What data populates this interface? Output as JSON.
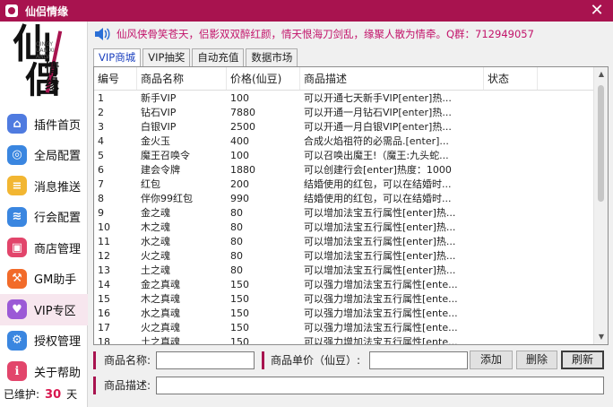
{
  "window": {
    "title": "仙侣情缘",
    "close_glyph": "✕"
  },
  "logo": {
    "main_top": "仙",
    "main_bottom": "侣",
    "small": "情缘",
    "pinyin": "QINGYUAN XIANLV"
  },
  "sidebar": {
    "items": [
      {
        "label": "插件首页",
        "icon": "home-icon",
        "color": "#4f7be0",
        "glyph": "⌂"
      },
      {
        "label": "全局配置",
        "icon": "settings-icon",
        "color": "#3a86e0",
        "glyph": "◎"
      },
      {
        "label": "消息推送",
        "icon": "message-icon",
        "color": "#f2b632",
        "glyph": "≡"
      },
      {
        "label": "行会配置",
        "icon": "layers-icon",
        "color": "#3a86e0",
        "glyph": "≋"
      },
      {
        "label": "商店管理",
        "icon": "shop-icon",
        "color": "#e2456b",
        "glyph": "▣"
      },
      {
        "label": "GM助手",
        "icon": "gm-icon",
        "color": "#f26b2a",
        "glyph": "⚒"
      },
      {
        "label": "VIP专区",
        "icon": "vip-icon",
        "color": "#9b59d6",
        "glyph": "♥"
      },
      {
        "label": "授权管理",
        "icon": "auth-icon",
        "color": "#3a86e0",
        "glyph": "⚙"
      },
      {
        "label": "关于帮助",
        "icon": "info-icon",
        "color": "#e2456b",
        "glyph": "ℹ"
      }
    ],
    "active_index": 6,
    "maintained_label": "已维护:",
    "maintained_days": "30",
    "maintained_unit": "天"
  },
  "notice": {
    "text": "仙风侠骨笑苍天，侣影双双醉红颜，情天恨海刀剑乱，缘聚人散为情牵。Q群：712949057"
  },
  "tabs": [
    {
      "label": "VIP商城",
      "active": true
    },
    {
      "label": "VIP抽奖",
      "active": false
    },
    {
      "label": "自动充值",
      "active": false
    },
    {
      "label": "数据市场",
      "active": false
    }
  ],
  "table": {
    "headers": [
      "编号",
      "商品名称",
      "价格(仙豆)",
      "商品描述",
      "状态"
    ],
    "rows": [
      [
        "1",
        "新手VIP",
        "100",
        "可以开通七天新手VIP[enter]热...",
        ""
      ],
      [
        "2",
        "钻石VIP",
        "7880",
        "可以开通一月钻石VIP[enter]热...",
        ""
      ],
      [
        "3",
        "白银VIP",
        "2500",
        "可以开通一月白银VIP[enter]热...",
        ""
      ],
      [
        "4",
        "金火玉",
        "400",
        "合成火焰祖符的必需品.[enter]...",
        ""
      ],
      [
        "5",
        "魔王召唤令",
        "100",
        "可以召唤出魔王!（魔王:九头蛇...",
        ""
      ],
      [
        "6",
        "建会令牌",
        "1880",
        "可以创建行会[enter]热度：1000",
        ""
      ],
      [
        "7",
        "红包",
        "200",
        "结婚使用的红包，可以在结婚时...",
        ""
      ],
      [
        "8",
        "伴你99红包",
        "990",
        "结婚使用的红包，可以在结婚时...",
        ""
      ],
      [
        "9",
        "金之魂",
        "80",
        "可以增加法宝五行属性[enter]热...",
        ""
      ],
      [
        "10",
        "木之魂",
        "80",
        "可以增加法宝五行属性[enter]热...",
        ""
      ],
      [
        "11",
        "水之魂",
        "80",
        "可以增加法宝五行属性[enter]热...",
        ""
      ],
      [
        "12",
        "火之魂",
        "80",
        "可以增加法宝五行属性[enter]热...",
        ""
      ],
      [
        "13",
        "土之魂",
        "80",
        "可以增加法宝五行属性[enter]热...",
        ""
      ],
      [
        "14",
        "金之真魂",
        "150",
        "可以强力增加法宝五行属性[ente...",
        ""
      ],
      [
        "15",
        "木之真魂",
        "150",
        "可以强力增加法宝五行属性[ente...",
        ""
      ],
      [
        "16",
        "水之真魂",
        "150",
        "可以强力增加法宝五行属性[ente...",
        ""
      ],
      [
        "17",
        "火之真魂",
        "150",
        "可以强力增加法宝五行属性[ente...",
        ""
      ],
      [
        "18",
        "土之真魂",
        "150",
        "可以强力增加法宝五行属性[ente...",
        ""
      ]
    ]
  },
  "form": {
    "name_label": "商品名称:",
    "name_value": "",
    "price_label": "商品单价（仙豆）:",
    "price_value": "",
    "desc_label": "商品描述:",
    "desc_value": "",
    "add_label": "添加",
    "delete_label": "删除",
    "refresh_label": "刷新"
  },
  "colors": {
    "accent": "#a8134f",
    "notice": "#c2136a",
    "days": "#d8174f"
  }
}
